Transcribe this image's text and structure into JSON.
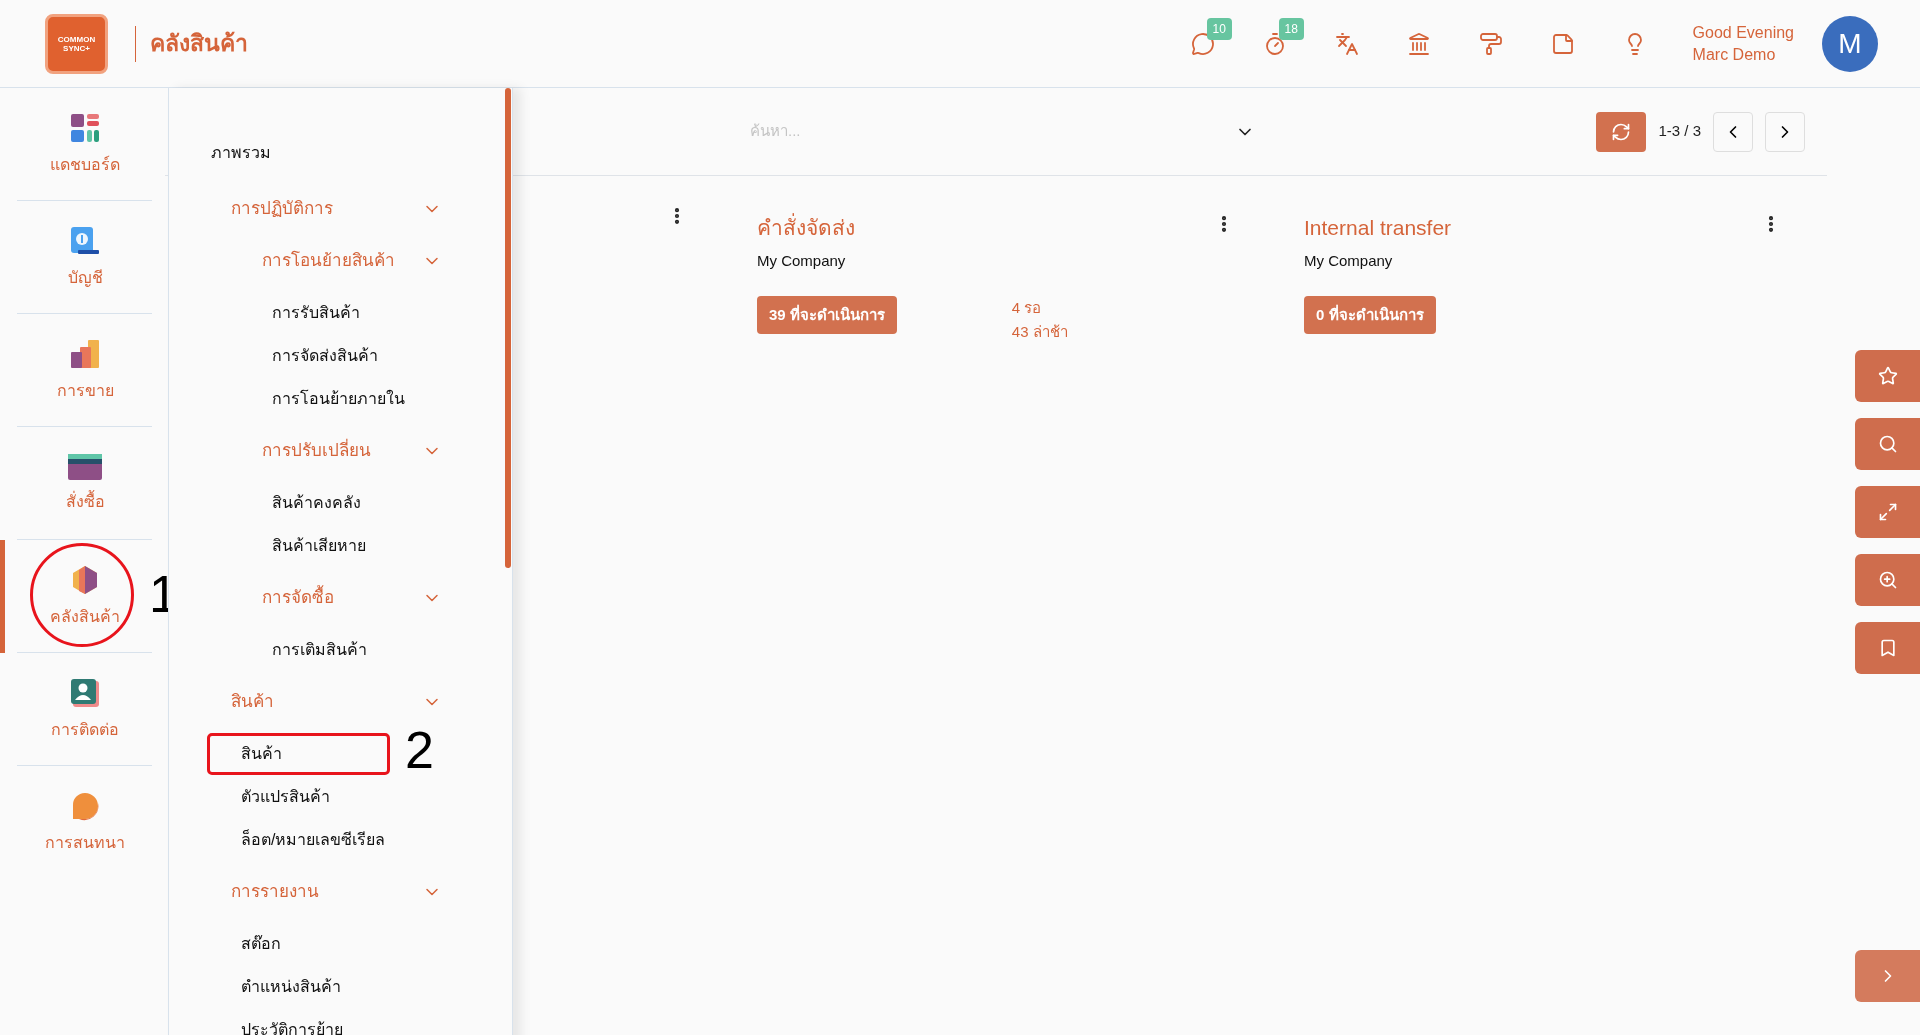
{
  "header": {
    "logo_text": "COMMON SYNC+",
    "title": "คลังสินค้า",
    "icons": [
      {
        "kind": "chat",
        "badge": "10"
      },
      {
        "kind": "timer",
        "badge": "18"
      },
      {
        "kind": "translate"
      },
      {
        "kind": "building"
      },
      {
        "kind": "roller"
      },
      {
        "kind": "note"
      },
      {
        "kind": "bulb"
      }
    ],
    "greeting": "Good Evening",
    "user_name": "Marc Demo",
    "avatar": "M"
  },
  "rail": [
    {
      "label": "แดชบอร์ด",
      "selected": false
    },
    {
      "label": "บัญชี",
      "selected": false
    },
    {
      "label": "การขาย",
      "selected": false
    },
    {
      "label": "สั่งซื้อ",
      "selected": false
    },
    {
      "label": "คลังสินค้า",
      "selected": true,
      "annotation": "1"
    },
    {
      "label": "การติดต่อ",
      "selected": false
    },
    {
      "label": "การสนทนา",
      "selected": false
    }
  ],
  "menu": {
    "items": [
      {
        "kind": "link",
        "label": "ภาพรวม"
      },
      {
        "kind": "section",
        "label": "การปฏิบัติการ",
        "expanded": true,
        "children": [
          {
            "kind": "section",
            "label": "การโอนย้ายสินค้า",
            "expanded": true,
            "children": [
              {
                "kind": "leaf",
                "label": "การรับสินค้า"
              },
              {
                "kind": "leaf",
                "label": "การจัดส่งสินค้า"
              },
              {
                "kind": "leaf",
                "label": "การโอนย้ายภายใน"
              }
            ]
          },
          {
            "kind": "section",
            "label": "การปรับเปลี่ยน",
            "expanded": true,
            "children": [
              {
                "kind": "leaf",
                "label": "สินค้าคงคลัง"
              },
              {
                "kind": "leaf",
                "label": "สินค้าเสียหาย"
              }
            ]
          },
          {
            "kind": "section",
            "label": "การจัดซื้อ",
            "expanded": true,
            "children": [
              {
                "kind": "leaf",
                "label": "การเติมสินค้า"
              }
            ]
          }
        ]
      },
      {
        "kind": "section",
        "label": "สินค้า",
        "expanded": true,
        "children": [
          {
            "kind": "leaf",
            "label": "สินค้า",
            "annotation": "2"
          },
          {
            "kind": "leaf",
            "label": "ตัวแปรสินค้า"
          },
          {
            "kind": "leaf",
            "label": "ล็อต/หมายเลขซีเรียล"
          }
        ]
      },
      {
        "kind": "section",
        "label": "การรายงาน",
        "expanded": true,
        "children": [
          {
            "kind": "leaf",
            "label": "สต๊อก"
          },
          {
            "kind": "leaf",
            "label": "ตำแหน่งสินค้า"
          },
          {
            "kind": "leaf",
            "label": "ประวัติการย้าย"
          }
        ]
      }
    ]
  },
  "toolbar": {
    "search_placeholder": "ค้นหา...",
    "pager": "1-3 / 3"
  },
  "cards": [
    {
      "kind": "covered"
    },
    {
      "kind": "task",
      "title": "คำสั่งจัดส่ง",
      "company": "My Company",
      "action": "39 ที่จะดำเนินการ",
      "stats": [
        "4 รอ",
        "43 ล่าช้า"
      ]
    },
    {
      "kind": "task",
      "title": "Internal transfer",
      "company": "My Company",
      "action": "0 ที่จะดำเนินการ"
    }
  ],
  "side_buttons": [
    {
      "kind": "star"
    },
    {
      "kind": "search"
    },
    {
      "kind": "expand"
    },
    {
      "kind": "zoom"
    },
    {
      "kind": "bookmark"
    }
  ]
}
